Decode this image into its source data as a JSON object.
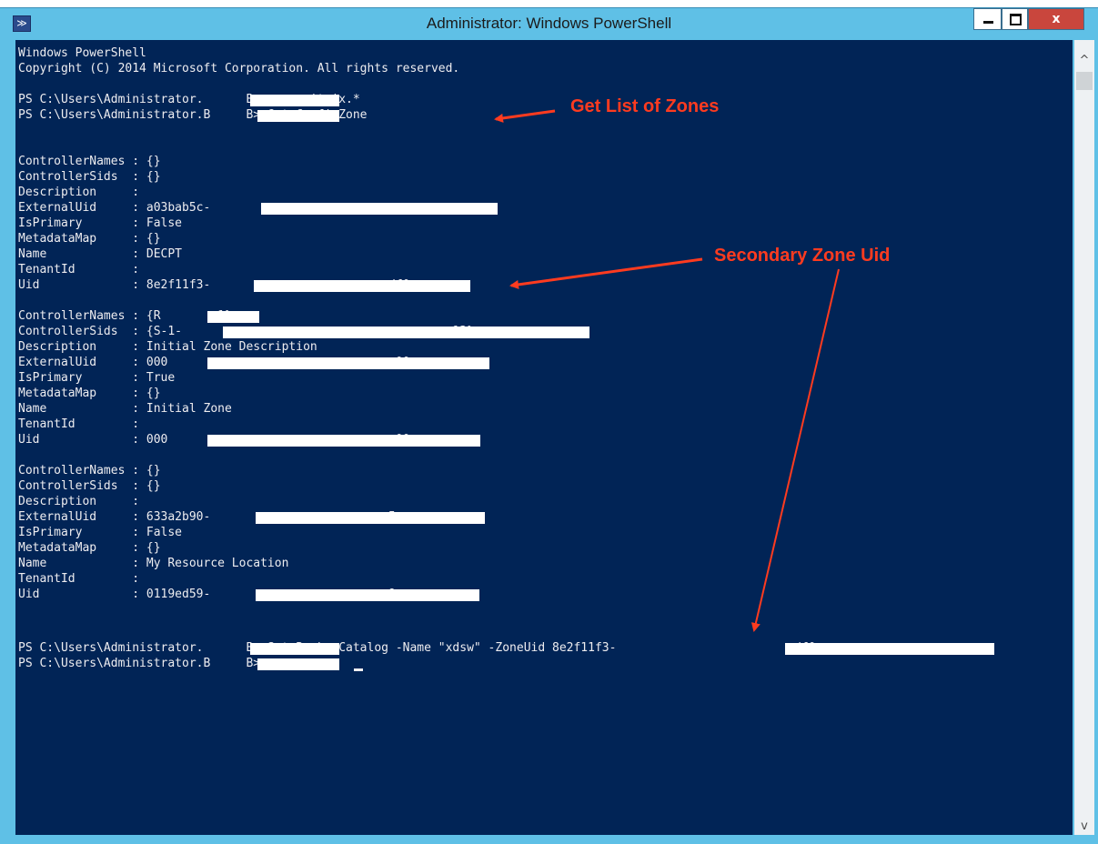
{
  "window": {
    "title": "Administrator: Windows PowerShell",
    "icon": "powershell-icon",
    "icon_glyph": "≫",
    "close_label": "x"
  },
  "console": {
    "lines": [
      "Windows PowerShell",
      "Copyright (C) 2014 Microsoft Corporation. All rights reserved.",
      "",
      "PS C:\\Users\\Administrator.      B> asnp citrix.*",
      "PS C:\\Users\\Administrator.B     B> Get-ConfigZone",
      "",
      "",
      "ControllerNames : {}",
      "ControllerSids  : {}",
      "Description     :",
      "ExternalUid     : a03bab5c-",
      "IsPrimary       : False",
      "MetadataMap     : {}",
      "Name            : DECPT",
      "TenantId        :",
      "Uid             : 8e2f11f3-                         df0",
      "",
      "ControllerNames : {R       -1}",
      "ControllerSids  : {S-1-                                      13}",
      "Description     : Initial Zone Description",
      "ExternalUid     : 000                                00",
      "IsPrimary       : True",
      "MetadataMap     : {}",
      "Name            : Initial Zone",
      "TenantId        :",
      "Uid             : 000                                00",
      "",
      "ControllerNames : {}",
      "ControllerSids  : {}",
      "Description     :",
      "ExternalUid     : 633a2b90-                         5",
      "IsPrimary       : False",
      "MetadataMap     : {}",
      "Name            : My Resource Location",
      "TenantId        :",
      "Uid             : 0119ed59-                         9e",
      "",
      "",
      "",
      "PS C:\\Users\\Administrator.      B> Set-BrokerCatalog -Name \"xdsw\" -ZoneUid 8e2f11f3-                         df0",
      "PS C:\\Users\\Administrator.B     B> "
    ]
  },
  "annotations": {
    "get_list": "Get List of Zones",
    "secondary_uid": "Secondary Zone Uid"
  },
  "colors": {
    "console_bg": "#012456",
    "console_text": "#eeedf0",
    "annotation": "#ff3b1f",
    "frame": "#5fc0e6",
    "close_button": "#c9463d"
  }
}
